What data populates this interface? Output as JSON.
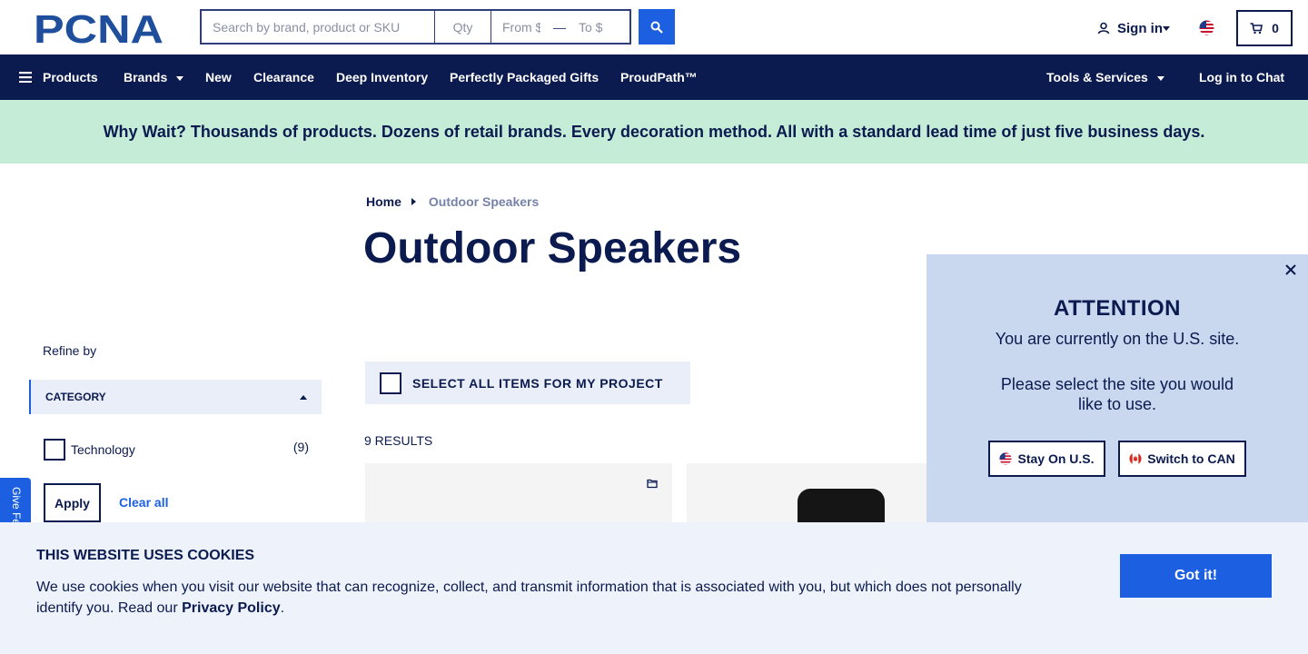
{
  "header": {
    "logo_text": "PCNA",
    "search": {
      "keyword_placeholder": "Search by brand, product or SKU",
      "qty_placeholder": "Qty",
      "price_from_placeholder": "From $",
      "price_to_placeholder": "To $"
    },
    "search_button_icon": "search-icon",
    "sign_in_label": "Sign in",
    "country_flag": "us-flag-icon",
    "cart_count": "0"
  },
  "nav": {
    "products": "Products",
    "brands": "Brands",
    "new": "New",
    "clearance": "Clearance",
    "deep_inventory": "Deep Inventory",
    "gifts": "Perfectly Packaged Gifts",
    "proudpath": "ProudPath™",
    "tools": "Tools & Services",
    "chat": "Log in to Chat"
  },
  "banner": {
    "text": "Why Wait? Thousands of products. Dozens of retail brands. Every decoration method. All with a standard lead time of just five business days."
  },
  "breadcrumb": {
    "home": "Home",
    "current": "Outdoor Speakers"
  },
  "page_title": "Outdoor Speakers",
  "sidebar": {
    "refine_by": "Refine by",
    "category_header": "CATEGORY",
    "filters": [
      {
        "label": "Technology",
        "count": "(9)"
      }
    ],
    "apply": "Apply",
    "clear_all": "Clear all",
    "feedback_tab": "Give Feedback"
  },
  "main": {
    "select_all": "SELECT ALL ITEMS FOR MY PROJECT",
    "results": "9 RESULTS"
  },
  "region_modal": {
    "title": "ATTENTION",
    "line1": "You are currently on the U.S. site.",
    "line2": "Please select the site you would like to use.",
    "stay_button": "Stay On U.S.",
    "switch_button": "Switch to CAN"
  },
  "cookie_banner": {
    "title": "THIS WEBSITE USES COOKIES",
    "body": "We use cookies when you visit our website that can recognize, collect, and transmit information that is associated with you, but which does not personally identify you. Read our ",
    "link": "Privacy Policy",
    "tail": ".",
    "button": "Got it!"
  },
  "colors": {
    "navy": "#0b1a4f",
    "accent_blue": "#1c5fe0",
    "banner_green": "#c4ecd6",
    "modal_bg": "#c9d7ef",
    "cookie_bg": "#edf2fb"
  }
}
